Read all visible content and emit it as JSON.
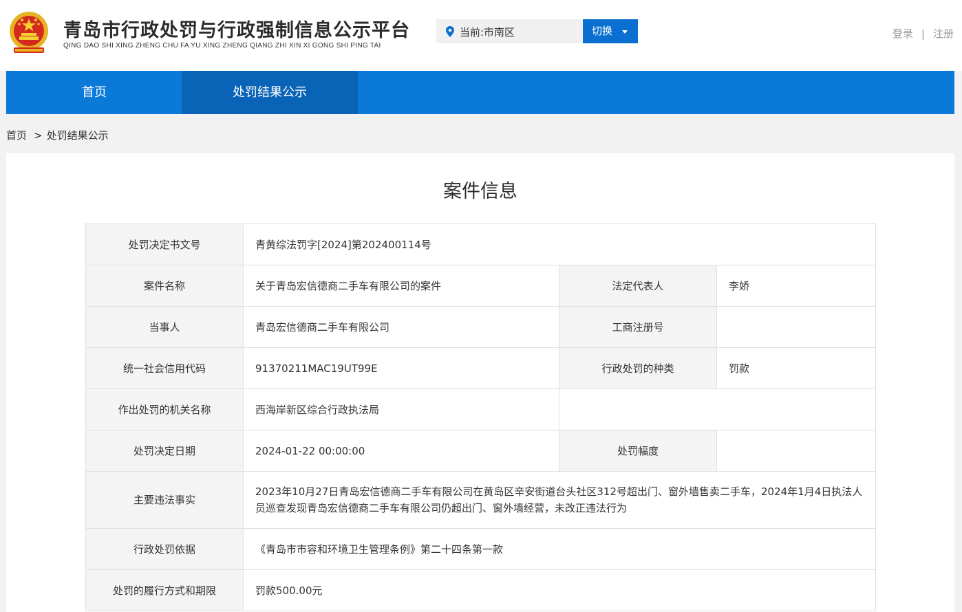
{
  "header": {
    "title": "青岛市行政处罚与行政强制信息公示平台",
    "pinyin": "QING DAO SHI XING ZHENG CHU FA YU XING ZHENG QIANG ZHI XIN XI GONG SHI PING TAI",
    "location": "当前:市南区",
    "switch_label": "切换",
    "login": "登录",
    "separator": "|",
    "register": "注册"
  },
  "nav": {
    "home": "首页",
    "results": "处罚结果公示"
  },
  "breadcrumb": {
    "home": "首页",
    "separator": ">",
    "current": "处罚结果公示"
  },
  "panel": {
    "title": "案件信息"
  },
  "case": {
    "doc_no_label": "处罚决定书文号",
    "doc_no": "青黄综法罚字[2024]第202400114号",
    "case_name_label": "案件名称",
    "case_name": "关于青岛宏信德商二手车有限公司的案件",
    "legal_rep_label": "法定代表人",
    "legal_rep": "李娇",
    "party_label": "当事人",
    "party": "青岛宏信德商二手车有限公司",
    "reg_no_label": "工商注册号",
    "reg_no": "",
    "credit_code_label": "统一社会信用代码",
    "credit_code": "91370211MAC19UT99E",
    "penalty_type_label": "行政处罚的种类",
    "penalty_type": "罚款",
    "authority_label": "作出处罚的机关名称",
    "authority": "西海岸新区综合行政执法局",
    "date_label": "处罚决定日期",
    "date": "2024-01-22 00:00:00",
    "range_label": "处罚幅度",
    "range": "",
    "facts_label": "主要违法事实",
    "facts": "2023年10月27日青岛宏信德商二手车有限公司在黄岛区辛安街道台头社区312号超出门、窗外墙售卖二手车，2024年1月4日执法人员巡查发现青岛宏信德商二手车有限公司仍超出门、窗外墙经营，未改正违法行为",
    "basis_label": "行政处罚依据",
    "basis": "《青岛市市容和环境卫生管理条例》第二十四条第一款",
    "execution_label": "处罚的履行方式和期限",
    "execution": "罚款500.00元"
  },
  "icons": {
    "emblem": "national-emblem",
    "pin": "location-pin-icon",
    "caret": "caret-down-icon"
  },
  "colors": {
    "nav_bg": "#0a79d8",
    "nav_active": "#0963b7",
    "switch_bg": "#0a6fd0"
  }
}
